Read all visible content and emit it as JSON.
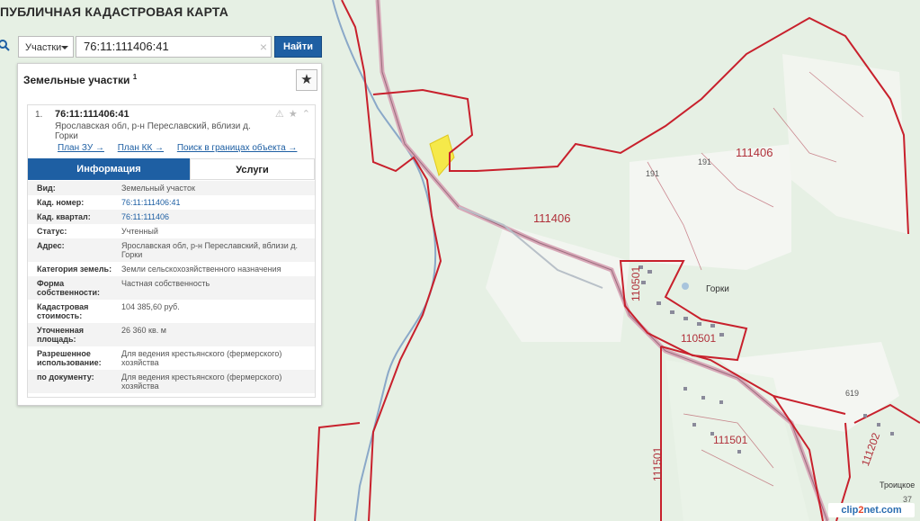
{
  "app": {
    "title": "ПУБЛИЧНАЯ КАДАСТРОВАЯ КАРТА"
  },
  "search": {
    "type_label": "Участки",
    "query": "76:11:111406:41",
    "clear_symbol": "×",
    "button_label": "Найти"
  },
  "panel": {
    "title": "Земельные участки",
    "count": "1",
    "result": {
      "index": "1.",
      "cadastral_number": "76:11:111406:41",
      "address": "Ярославская обл, р-н Переславский, вблизи д. Горки",
      "links": [
        "План ЗУ →",
        "План КК →",
        "Поиск в границах объекта →"
      ]
    },
    "tabs": [
      {
        "label": "Информация",
        "active": true
      },
      {
        "label": "Услуги",
        "active": false
      }
    ],
    "rows": [
      {
        "key": "Вид:",
        "value": "Земельный участок"
      },
      {
        "key": "Кад. номер:",
        "value": "76:11:111406:41"
      },
      {
        "key": "Кад. квартал:",
        "value": "76:11:111406"
      },
      {
        "key": "Статус:",
        "value": "Учтенный"
      },
      {
        "key": "Адрес:",
        "value": "Ярославская обл, р-н Переславский, вблизи д. Горки"
      },
      {
        "key": "Категория земель:",
        "value": "Земли сельскохозяйственного назначения"
      },
      {
        "key": "Форма собственности:",
        "value": "Частная собственность"
      },
      {
        "key": "Кадастровая стоимость:",
        "value": "104 385,60 руб."
      },
      {
        "key": "Уточненная площадь:",
        "value": "26 360 кв. м"
      },
      {
        "key": "Разрешенное использование:",
        "value": "Для ведения крестьянского (фермерского) хозяйства"
      },
      {
        "key": "по документу:",
        "value": "Для ведения крестьянского (фермерского) хозяйства"
      }
    ]
  },
  "map": {
    "labels": {
      "q111406_center": "111406",
      "q111406_right": "111406",
      "q110501_a": "110501",
      "q110501_b": "110501",
      "q111501_a": "111501",
      "q111501_b": "111501",
      "q111202": "111202",
      "n191_a": "191",
      "n191_b": "191",
      "n619": "619",
      "n37": "37",
      "place_gorki": "Горки",
      "place_troitskoe": "Троицкое"
    },
    "colors": {
      "parcel_border": "#c8202c",
      "road": "#d8a8b8",
      "river": "#8aa8c8",
      "selected_parcel": "#f5e94a",
      "background": "#e6f0e4",
      "accent_blue": "#1e5fa3"
    }
  },
  "watermark": {
    "part1": "clip",
    "part2": "2",
    "part3": "net.com"
  }
}
